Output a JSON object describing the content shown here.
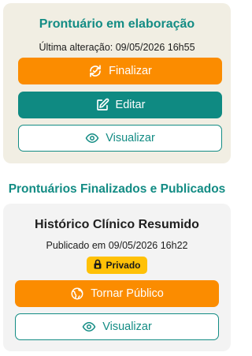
{
  "draft": {
    "title": "Prontuário em elaboração",
    "last_change": "Última alteração: 09/05/2026 16h55",
    "finalize_label": "Finalizar",
    "edit_label": "Editar",
    "view_label": "Visualizar"
  },
  "published": {
    "section_title": "Prontuários Finalizados e Publicados",
    "record_title": "Histórico Clínico Resumido",
    "published_at": "Publicado em 09/05/2026 16h22",
    "badge_label": "Privado",
    "make_public_label": "Tornar Público",
    "view_label": "Visualizar"
  },
  "icons": {
    "finalize": "refresh-check-icon",
    "edit": "edit-icon",
    "view": "eye-icon",
    "badge": "lock-icon",
    "make_public": "globe-icon"
  },
  "colors": {
    "primary_teal": "#138c84",
    "accent_orange": "#fb8c00",
    "badge_yellow": "#ffc107",
    "draft_card_bg": "#f1eee3",
    "final_card_bg": "#f3f3f3"
  }
}
